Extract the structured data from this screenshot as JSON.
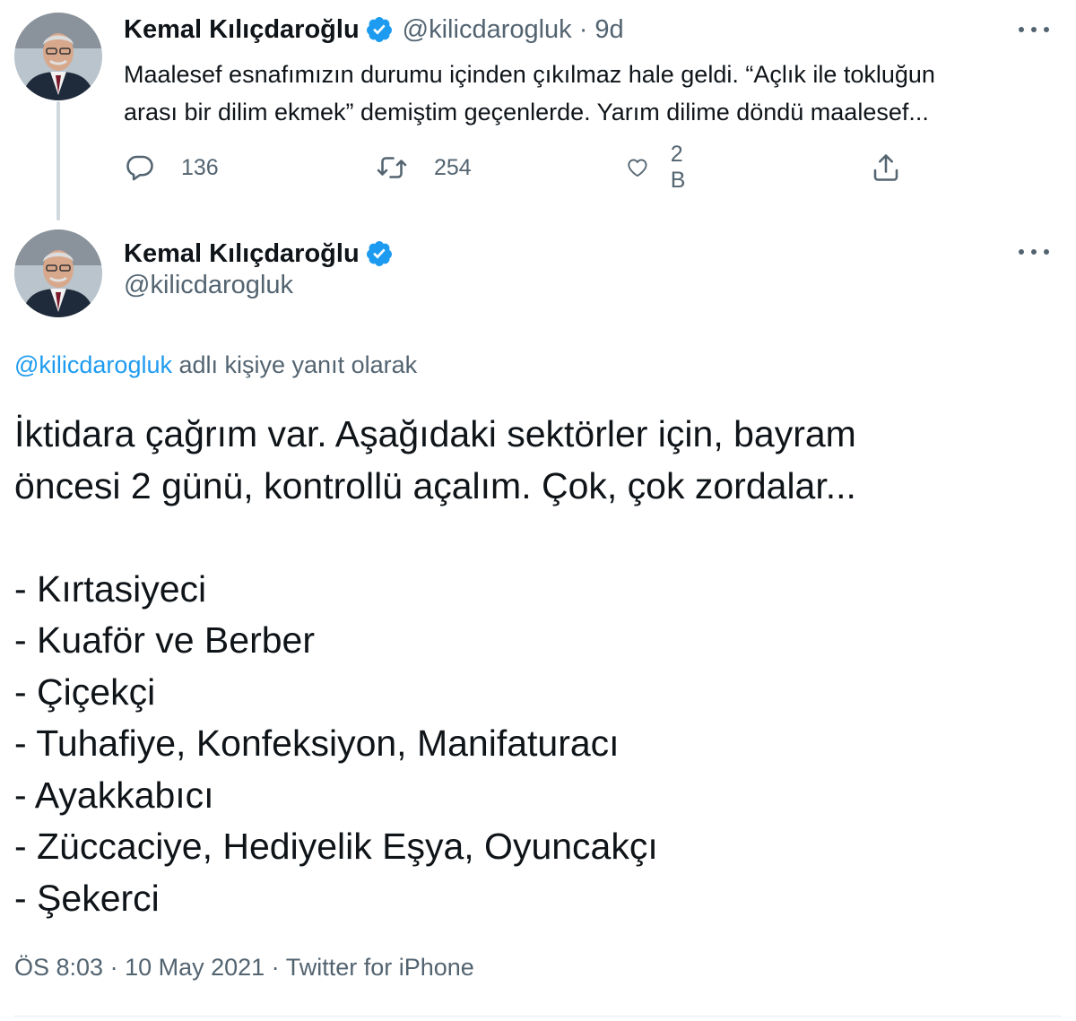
{
  "colors": {
    "text": "#0f1419",
    "muted": "#536471",
    "link": "#1d9bf0",
    "verified_badge": "#1d9bf0",
    "thread_line": "#cfd9de"
  },
  "tweet1": {
    "display_name": "Kemal Kılıçdaroğlu",
    "handle": "@kilicdarogluk",
    "separator": "·",
    "time_ago": "9d",
    "text_lines": [
      "Maalesef esnafımızın durumu içinden çıkılmaz hale geldi. “Açlık ile tokluğun",
      "arası bir dilim ekmek” demiştim geçenlerde. Yarım dilime döndü maalesef..."
    ],
    "actions": {
      "reply_count": "136",
      "retweet_count": "254",
      "like_count": "2 B"
    },
    "icons": [
      "reply-icon",
      "retweet-icon",
      "like-icon",
      "share-icon",
      "more-icon",
      "verified-icon"
    ]
  },
  "tweet2": {
    "display_name": "Kemal Kılıçdaroğlu",
    "handle": "@kilicdarogluk",
    "reply_mention": "@kilicdarogluk",
    "reply_suffix": " adlı kişiye yanıt olarak",
    "text_lines": [
      "İktidara çağrım var. Aşağıdaki sektörler için, bayram",
      "öncesi 2 günü, kontrollü açalım. Çok, çok zordalar...",
      "",
      "- Kırtasiyeci",
      "- Kuaför ve Berber",
      "- Çiçekçi",
      "- Tuhafiye, Konfeksiyon, Manifaturacı",
      "- Ayakkabıcı",
      "- Züccaciye, Hediyelik Eşya, Oyuncakçı",
      "- Şekerci"
    ],
    "time": "ÖS 8:03",
    "date": "10 May 2021",
    "source": "Twitter for iPhone",
    "meta_separator": " · "
  }
}
